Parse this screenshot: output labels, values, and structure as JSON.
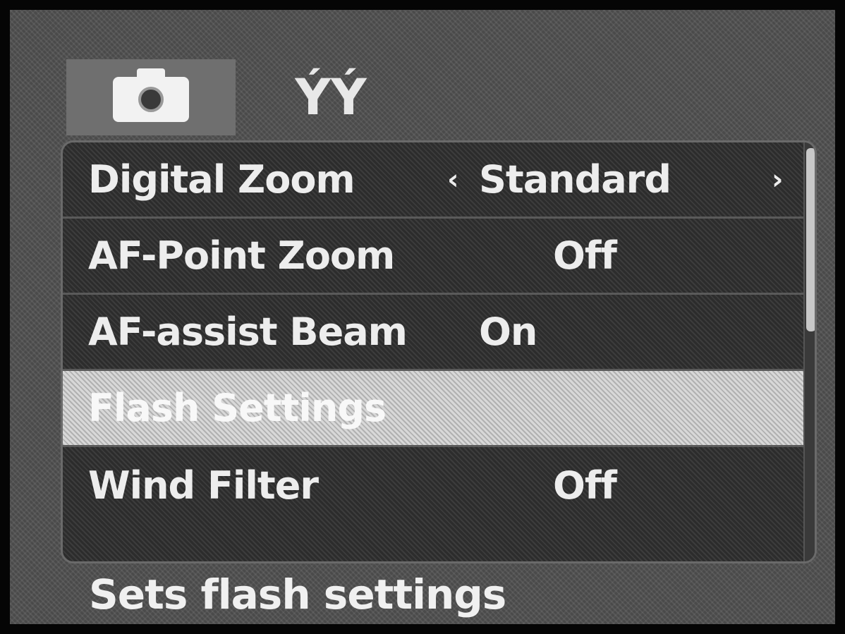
{
  "tabs": [
    {
      "icon": "camera-icon",
      "active": true
    },
    {
      "icon": "tools-icon",
      "active": false,
      "glyph": "ÝÝ"
    }
  ],
  "menu": {
    "items": [
      {
        "label": "Digital Zoom",
        "value": "Standard",
        "arrow_left": "‹",
        "arrow_right": "›"
      },
      {
        "label": "AF-Point Zoom",
        "value": "Off"
      },
      {
        "label": "AF-assist Beam",
        "value": "On"
      },
      {
        "label": "Flash Settings",
        "value": ""
      },
      {
        "label": "Wind Filter",
        "value": "Off"
      }
    ],
    "selected_index": 3
  },
  "hint": "Sets flash settings",
  "colors": {
    "highlight": "#d8d8d8",
    "panel": "#2c2c2c",
    "text": "#ededed"
  }
}
